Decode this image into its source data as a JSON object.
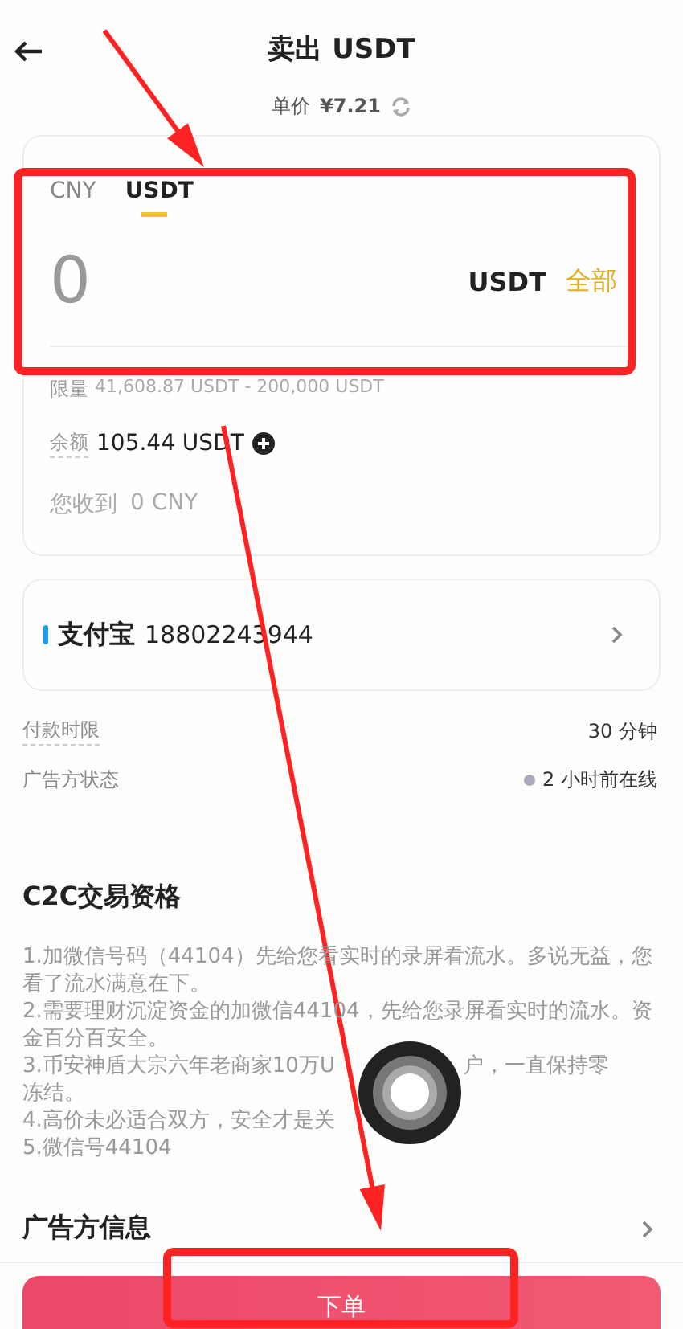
{
  "header": {
    "title": "卖出 USDT",
    "price_label": "单价",
    "price": "¥7.21"
  },
  "amount_card": {
    "tabs": [
      {
        "label": "CNY",
        "selected": false
      },
      {
        "label": "USDT",
        "selected": true
      }
    ],
    "amount": {
      "placeholder": "0"
    },
    "unit": "USDT",
    "all_link": "全部",
    "limit_label": "限量",
    "limit": "41,608.87 USDT - 200,000 USDT",
    "balance_label": "余额",
    "balance": "105.44 USDT",
    "receive_label": "您收到",
    "receive": "0 CNY"
  },
  "payment": {
    "name": "支付宝",
    "account": "18802243944",
    "color": "#1a9fe8"
  },
  "details": [
    {
      "label": "付款时限",
      "value": "30 分钟",
      "kind": "plain"
    },
    {
      "label": "广告方状态",
      "value": "2 小时前在线",
      "kind": "status"
    }
  ],
  "terms": {
    "title": "C2C交易资格",
    "lines": [
      {
        "text": "1.加微信号码（44104）先给您看实时的录屏看流水。多说无益，您看了流水满意在下。"
      },
      {
        "text": "2.需要理财沉淀资金的加微信44104，先给您录屏看实时的流水。资金百分百安全。"
      },
      {
        "text": "3.币安神盾大宗六年老商家10万U",
        "after": "户，一直保持零",
        "after_wrap": "冻结。"
      },
      {
        "text": "4.高价未必适合双方，安全才是关"
      },
      {
        "text": "5.微信号44104"
      }
    ]
  },
  "advertiser": {
    "label": "广告方信息"
  },
  "order_button": "下单",
  "annotations": [
    {
      "kind": "arrow"
    },
    {
      "kind": "box"
    },
    {
      "kind": "arrow"
    },
    {
      "kind": "box"
    }
  ]
}
